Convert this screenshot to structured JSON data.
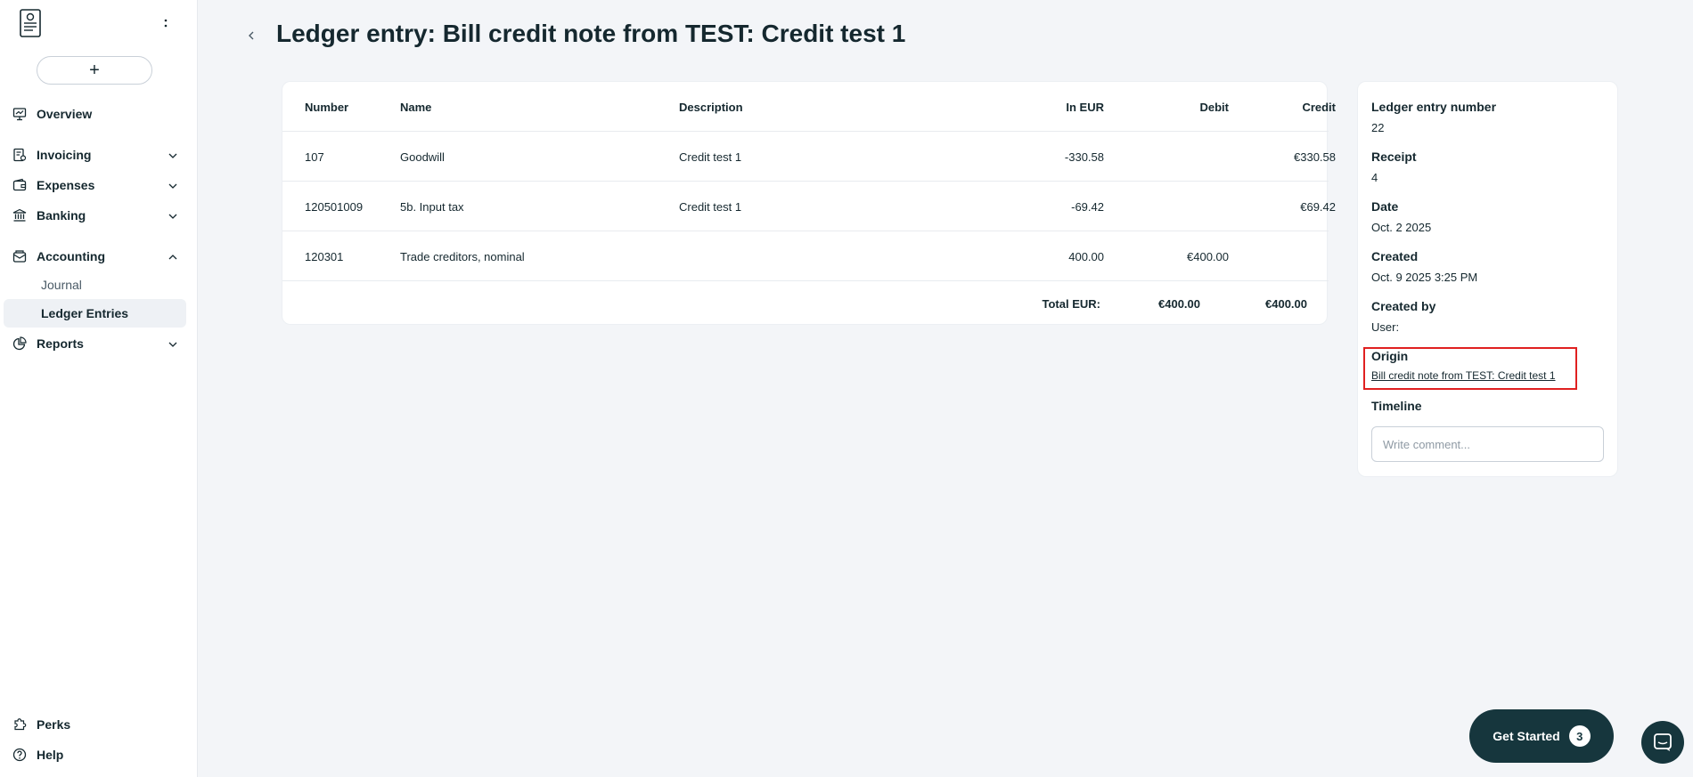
{
  "sidebar": {
    "new_button_label": "+",
    "items": [
      {
        "label": "Overview",
        "icon": "presentation-icon"
      },
      {
        "label": "Invoicing",
        "icon": "invoice-icon"
      },
      {
        "label": "Expenses",
        "icon": "wallet-icon"
      },
      {
        "label": "Banking",
        "icon": "bank-icon"
      },
      {
        "label": "Accounting",
        "icon": "ledger-icon"
      },
      {
        "label": "Reports",
        "icon": "pie-chart-icon"
      }
    ],
    "accounting_sub": [
      {
        "label": "Journal"
      },
      {
        "label": "Ledger Entries",
        "active": true
      }
    ],
    "bottom": [
      {
        "label": "Perks",
        "icon": "puzzle-icon"
      },
      {
        "label": "Help",
        "icon": "help-icon"
      }
    ]
  },
  "page": {
    "title": "Ledger entry: Bill credit note from TEST: Credit test 1"
  },
  "table": {
    "headers": {
      "number": "Number",
      "name": "Name",
      "description": "Description",
      "in_eur": "In EUR",
      "debit": "Debit",
      "credit": "Credit"
    },
    "rows": [
      {
        "number": "107",
        "name": "Goodwill",
        "description": "Credit test 1",
        "in_eur": "-330.58",
        "debit": "",
        "credit": "€330.58"
      },
      {
        "number": "120501009",
        "name": "5b. Input tax",
        "description": "Credit test 1",
        "in_eur": "-69.42",
        "debit": "",
        "credit": "€69.42"
      },
      {
        "number": "120301",
        "name": "Trade creditors, nominal",
        "description": "",
        "in_eur": "400.00",
        "debit": "€400.00",
        "credit": ""
      }
    ],
    "total": {
      "label": "Total EUR:",
      "debit": "€400.00",
      "credit": "€400.00"
    }
  },
  "details": {
    "entry_number_label": "Ledger entry number",
    "entry_number": "22",
    "receipt_label": "Receipt",
    "receipt": "4",
    "date_label": "Date",
    "date": "Oct. 2 2025",
    "created_label": "Created",
    "created": "Oct. 9 2025 3:25 PM",
    "created_by_label": "Created by",
    "created_by": "User:",
    "origin_label": "Origin",
    "origin_link": "Bill credit note from TEST: Credit test 1",
    "timeline_label": "Timeline",
    "comment_placeholder": "Write comment..."
  },
  "get_started": {
    "label": "Get Started",
    "count": "3"
  },
  "colors": {
    "primary": "#16363d",
    "highlight": "#e02020",
    "background": "#f3f5f8"
  }
}
